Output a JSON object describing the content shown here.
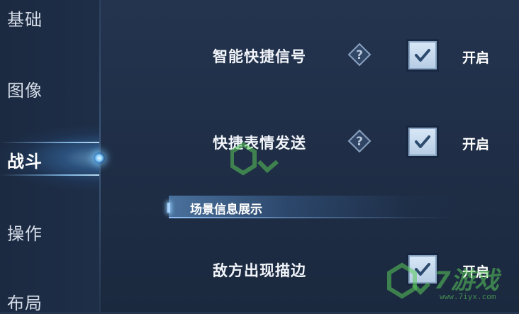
{
  "sidebar": {
    "items": [
      {
        "label": "基础"
      },
      {
        "label": "图像"
      },
      {
        "label": "战斗",
        "active": true
      },
      {
        "label": "操作"
      },
      {
        "label": "布局"
      }
    ]
  },
  "settings": [
    {
      "label": "智能快捷信号",
      "has_help": true,
      "checked": true,
      "status": "开启"
    },
    {
      "label": "快捷表情发送",
      "has_help": true,
      "checked": true,
      "status": "开启"
    },
    {
      "label": "敌方出现描边",
      "has_help": false,
      "checked": true,
      "status": "开启"
    }
  ],
  "section": {
    "title": "场景信息展示"
  },
  "watermark": {
    "text": "7游戏",
    "url": "www.7iyx.com"
  },
  "colors": {
    "accent": "#5bb0ff",
    "checkbox": "#c5d9ee",
    "check": "#2c4a6e",
    "watermark": "#5ac85a"
  }
}
